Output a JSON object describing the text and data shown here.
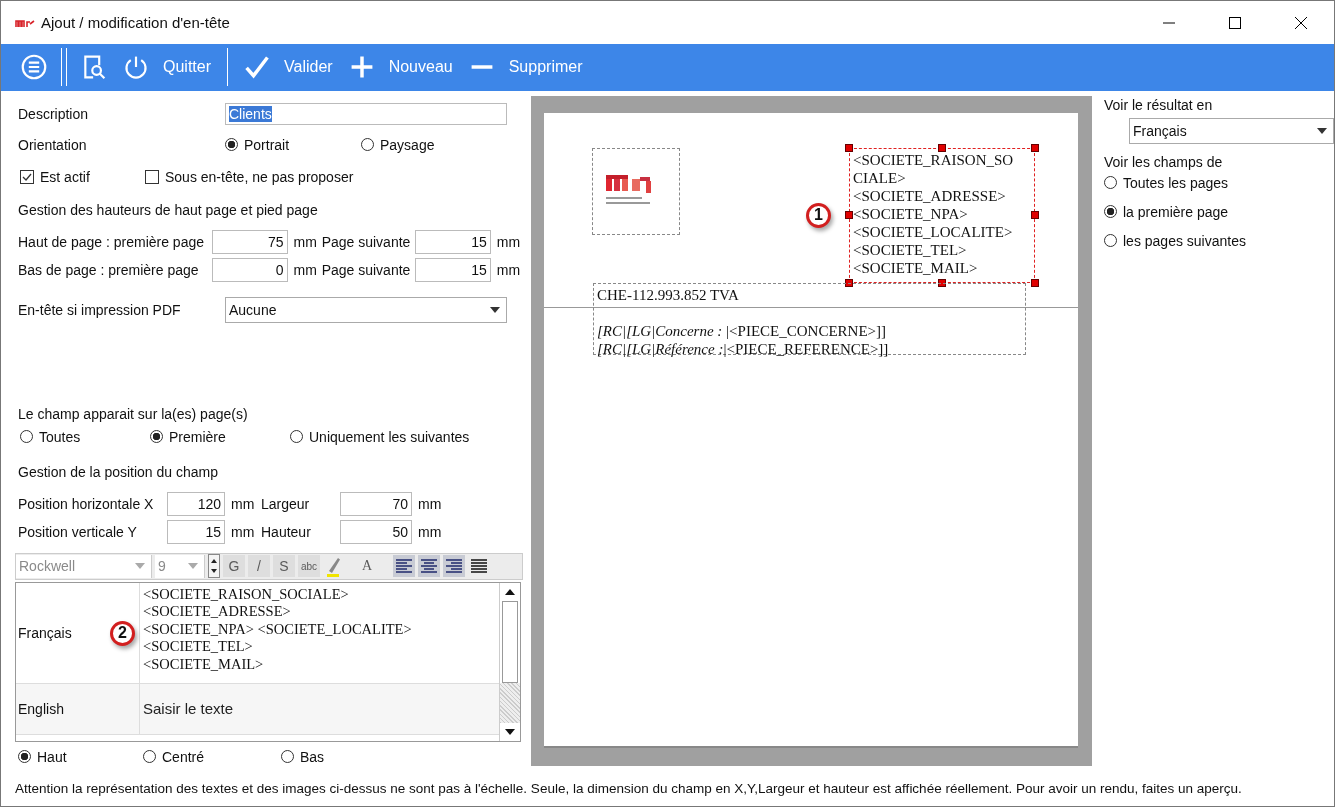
{
  "window": {
    "title": "Ajout / modification d'en-tête"
  },
  "toolbar": [
    {
      "kind": "menu"
    },
    {
      "kind": "separator"
    },
    {
      "kind": "preview"
    },
    {
      "kind": "power",
      "label": "Quitter"
    },
    {
      "kind": "separator"
    },
    {
      "kind": "check",
      "label": "Valider"
    },
    {
      "kind": "plus",
      "label": "Nouveau"
    },
    {
      "kind": "minus",
      "label": "Supprimer"
    }
  ],
  "form": {
    "description": {
      "label": "Description",
      "value": "Clients",
      "text_selected": true
    },
    "orientation": {
      "label": "Orientation",
      "options": [
        {
          "label": "Portrait",
          "selected": true
        },
        {
          "label": "Paysage",
          "selected": false
        }
      ]
    },
    "checkboxes": [
      {
        "label": "Est actif",
        "checked": true
      },
      {
        "label": "Sous en-tête, ne pas proposer",
        "checked": false
      }
    ],
    "heights": {
      "heading": "Gestion des hauteurs de haut page et pied page",
      "rows": [
        {
          "label": "Haut de page : première page",
          "value": "75",
          "unit": "mm",
          "next_label": "Page suivante",
          "next_value": "15",
          "next_unit": "mm"
        },
        {
          "label": "Bas de page  : première page",
          "value": "0",
          "unit": "mm",
          "next_label": "Page suivante",
          "next_value": "15",
          "next_unit": "mm"
        }
      ]
    },
    "pdf_header": {
      "label": "En-tête si impression PDF",
      "value": "Aucune"
    },
    "appears_on": {
      "label": "Le champ apparait sur la(es) page(s)",
      "options": [
        {
          "label": "Toutes",
          "selected": false
        },
        {
          "label": "Première",
          "selected": true
        },
        {
          "label": "Uniquement les suivantes",
          "selected": false
        }
      ]
    },
    "position": {
      "heading": "Gestion de la position du champ",
      "rows": [
        {
          "label": "Position horizontale X",
          "value": "120",
          "unit": "mm",
          "next_label": "Largeur",
          "next_value": "70",
          "next_unit": "mm"
        },
        {
          "label": "Position verticale Y",
          "value": "15",
          "unit": "mm",
          "next_label": "Hauteur",
          "next_value": "50",
          "next_unit": "mm"
        }
      ]
    },
    "format_toolbar": {
      "font": "Rockwell",
      "size": "9",
      "disabled": true,
      "items": [
        {
          "kind": "text",
          "label": "G"
        },
        {
          "kind": "text",
          "label": "/"
        },
        {
          "kind": "text",
          "label": "S"
        },
        {
          "kind": "text",
          "label": "abc"
        },
        {
          "kind": "pen"
        },
        {
          "kind": "plain",
          "label": "A"
        },
        {
          "kind": "align_left"
        },
        {
          "kind": "align_center"
        },
        {
          "kind": "align_right"
        },
        {
          "kind": "justify"
        }
      ]
    },
    "translations": [
      {
        "language": "Français",
        "lines": [
          "<SOCIETE_RAISON_SOCIALE>",
          "<SOCIETE_ADRESSE>",
          "<SOCIETE_NPA> <SOCIETE_LOCALITE>",
          "<SOCIETE_TEL>",
          "<SOCIETE_MAIL>"
        ],
        "badge": "2"
      },
      {
        "language": "English",
        "placeholder": "Saisir le texte"
      }
    ],
    "vertical_align": [
      {
        "label": "Haut",
        "selected": true
      },
      {
        "label": "Centré",
        "selected": false
      },
      {
        "label": "Bas",
        "selected": false
      }
    ]
  },
  "preview": {
    "blocks": [
      {
        "kind": "logo",
        "selected": false
      },
      {
        "kind": "text",
        "selected": true,
        "badge": "1",
        "lines": [
          "<SOCIETE_RAISON_SO",
          "CIALE>",
          "<SOCIETE_ADRESSE>",
          "<SOCIETE_NPA>",
          "<SOCIETE_LOCALITE>",
          "<SOCIETE_TEL>",
          "<SOCIETE_MAIL>"
        ]
      },
      {
        "kind": "paragraphs",
        "selected": false,
        "paragraphs": [
          [
            "CHE-112.993.852 TVA"
          ],
          [
            "*[RC|[LG|Concerne :* |<PIECE_CONCERNE>]]",
            "*[RC|[LG|Référence :*|<PIECE_REFERENCE>]]"
          ]
        ]
      }
    ]
  },
  "result": {
    "label": "Voir le résultat en",
    "value": "Français"
  },
  "fields_of": {
    "label": "Voir les champs de",
    "options": [
      {
        "label": "Toutes les pages",
        "selected": false
      },
      {
        "label": "la première page",
        "selected": true
      },
      {
        "label": "les pages suivantes",
        "selected": false
      }
    ]
  },
  "status_note": "Attention la représentation des textes et des images ci-dessus ne sont pas à l'échelle. Seule, la dimension du champ en X,Y,Largeur et hauteur est affichée réellement. Pour avoir un rendu, faites un aperçu."
}
